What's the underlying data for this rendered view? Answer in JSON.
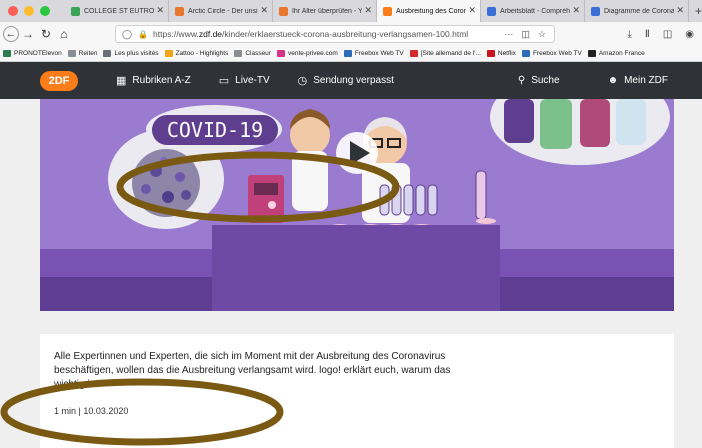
{
  "browser": {
    "tabs": [
      {
        "label": "COLLEGE ST EUTROPE",
        "favicon_color": "#3aa356",
        "active": false
      },
      {
        "label": "Arctic Circle - Der unsi",
        "favicon_color": "#e8772e",
        "active": false
      },
      {
        "label": "Ihr Alter überprüfen - Y",
        "favicon_color": "#e8772e",
        "active": false
      },
      {
        "label": "Ausbreitung des Corona",
        "favicon_color": "#fa7d19",
        "active": true
      },
      {
        "label": "Arbeitsblatt - Compréhe",
        "favicon_color": "#3a6fd8",
        "active": false
      },
      {
        "label": "Diagramme de Coronav",
        "favicon_color": "#3a6fd8",
        "active": false
      }
    ],
    "url_prefix": "https://www.",
    "url_domain": "zdf.de",
    "url_path": "/kinder/erklaerstueck-corona-ausbreitung-verlangsamen-100.html",
    "url_more": "···",
    "bookmarks": [
      {
        "label": "PRONOTElevon",
        "color": "#2f7d4e"
      },
      {
        "label": "Reiten",
        "color": "#8a8f96"
      },
      {
        "label": "Les plus visités",
        "color": "#6a6f76"
      },
      {
        "label": "Zattoo - Highlights",
        "color": "#f0a418"
      },
      {
        "label": "Classeur",
        "color": "#8a8f96"
      },
      {
        "label": "vente-privee.com",
        "color": "#d6338a"
      },
      {
        "label": "Freebox Web TV",
        "color": "#2b6bb7"
      },
      {
        "label": "[Site allemand de l'...",
        "color": "#d62a2a"
      },
      {
        "label": "Netflix",
        "color": "#c9141f"
      },
      {
        "label": "Freebox Web TV",
        "color": "#2b6bb7"
      },
      {
        "label": "Amazon France",
        "color": "#222222"
      }
    ]
  },
  "zdf": {
    "logo": "2DF",
    "nav": [
      {
        "label": "Rubriken A-Z",
        "icon": "grid-icon"
      },
      {
        "label": "Live-TV",
        "icon": "monitor-icon"
      },
      {
        "label": "Sendung verpasst",
        "icon": "clock-icon"
      }
    ],
    "search_label": "Suche",
    "profile_label": "Mein ZDF",
    "accent": "#fa7d19",
    "header_bg": "#2f3237"
  },
  "video": {
    "badge_text": "COVID-19",
    "purple": "#8d6ac4"
  },
  "article": {
    "description": "Alle Expertinnen und Experten, die sich im Moment mit der Ausbreitung des Coronavirus beschäftigen, wollen das die Ausbreitung verlangsamt wird. logo! erklärt euch, warum das wichtig ist.",
    "meta": "1 min | 10.03.2020"
  },
  "annotation_color": "#7a5a12"
}
